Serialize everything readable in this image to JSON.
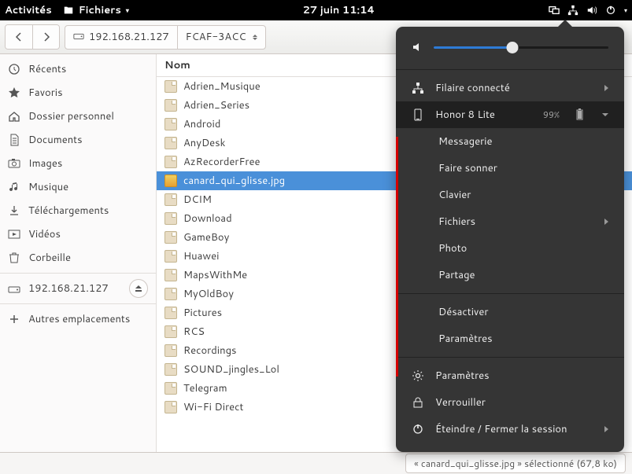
{
  "topbar": {
    "activities": "Activités",
    "app": "Fichiers",
    "datetime": "27 juin  11:14"
  },
  "path": {
    "address": "192.168.21.127",
    "crumb": "FCAF-3ACC"
  },
  "colhead": "Nom",
  "sidebar": [
    {
      "label": "Récents",
      "icon": "clock"
    },
    {
      "label": "Favoris",
      "icon": "star"
    },
    {
      "label": "Dossier personnel",
      "icon": "home"
    },
    {
      "label": "Documents",
      "icon": "doc"
    },
    {
      "label": "Images",
      "icon": "camera"
    },
    {
      "label": "Musique",
      "icon": "music"
    },
    {
      "label": "Téléchargements",
      "icon": "download"
    },
    {
      "label": "Vidéos",
      "icon": "video"
    },
    {
      "label": "Corbeille",
      "icon": "trash"
    },
    {
      "label": "192.168.21.127",
      "icon": "drive",
      "sep": true,
      "eject": true
    },
    {
      "label": "Autres emplacements",
      "icon": "plus",
      "sep": true
    }
  ],
  "files": [
    {
      "name": "Adrien_Musique",
      "type": "folder"
    },
    {
      "name": "Adrien_Series",
      "type": "folder"
    },
    {
      "name": "Android",
      "type": "folder"
    },
    {
      "name": "AnyDesk",
      "type": "folder"
    },
    {
      "name": "AzRecorderFree",
      "type": "folder"
    },
    {
      "name": "canard_qui_glisse.jpg",
      "type": "image",
      "selected": true
    },
    {
      "name": "DCIM",
      "type": "folder"
    },
    {
      "name": "Download",
      "type": "folder"
    },
    {
      "name": "GameBoy",
      "type": "folder"
    },
    {
      "name": "Huawei",
      "type": "folder"
    },
    {
      "name": "MapsWithMe",
      "type": "folder"
    },
    {
      "name": "MyOldBoy",
      "type": "folder"
    },
    {
      "name": "Pictures",
      "type": "folder"
    },
    {
      "name": "RCS",
      "type": "folder"
    },
    {
      "name": "Recordings",
      "type": "folder"
    },
    {
      "name": "SOUND_jingles_Lol",
      "type": "folder"
    },
    {
      "name": "Telegram",
      "type": "folder"
    },
    {
      "name": "Wi-Fi Direct",
      "type": "folder"
    }
  ],
  "status": "« canard_qui_glisse.jpg » sélectionné  (67,8 ko)",
  "popover": {
    "volume": 45,
    "wired": "Filaire connecté",
    "device": "Honor 8 Lite",
    "battery": "99%",
    "sub": [
      "Messagerie",
      "Faire sonner",
      "Clavier",
      "Fichiers",
      "Photo",
      "Partage",
      "Désactiver",
      "Paramètres"
    ],
    "settings": "Paramètres",
    "lock": "Verrouiller",
    "power": "Éteindre / Fermer la session"
  }
}
